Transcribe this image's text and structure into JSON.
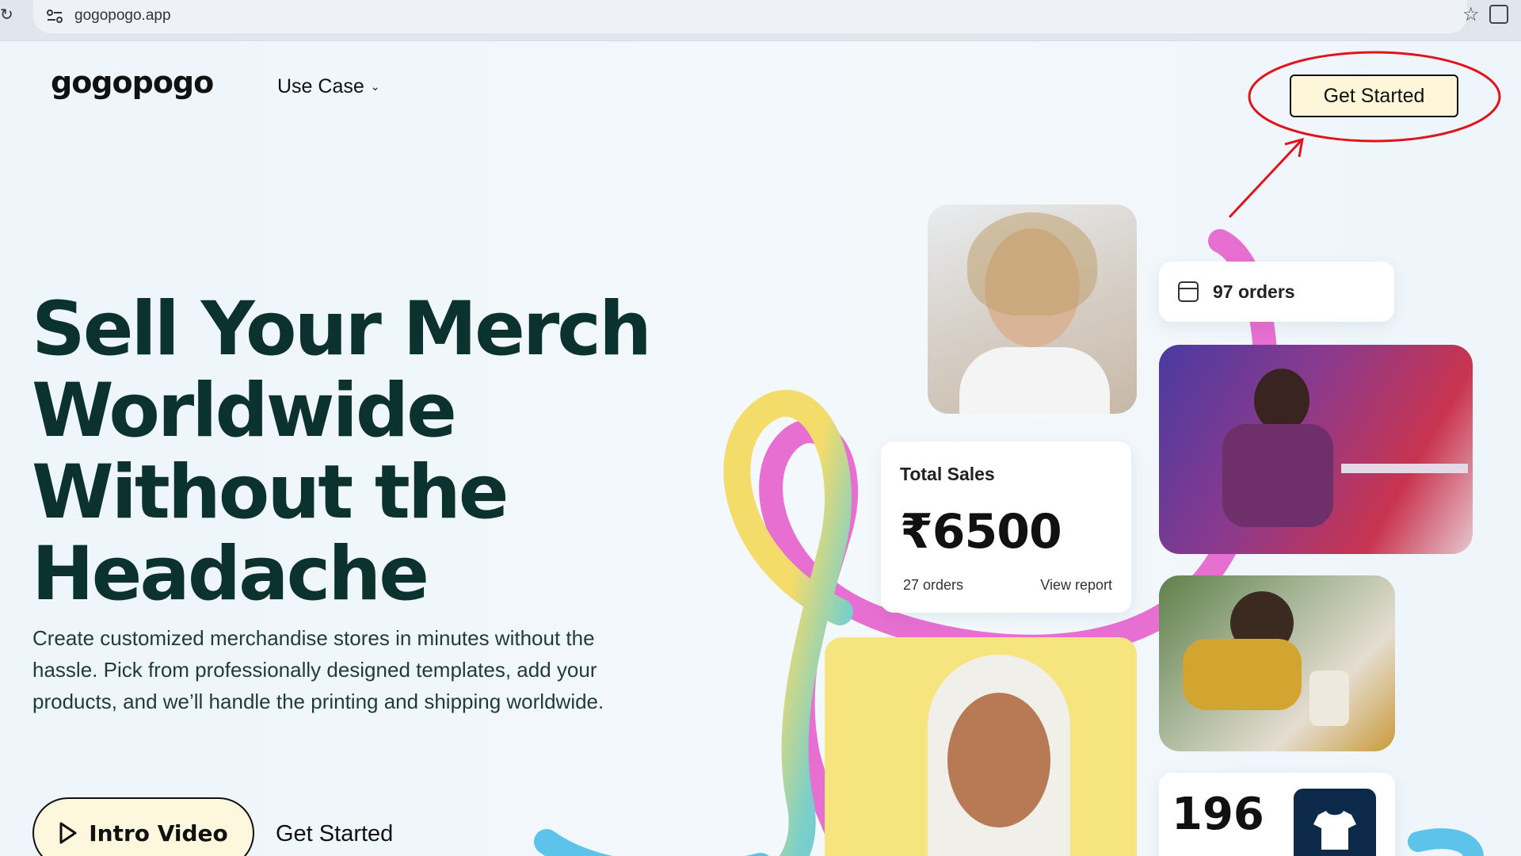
{
  "browser": {
    "url": "gogopogo.app",
    "reload_icon": "reload-icon",
    "site_info_icon": "site-info-icon",
    "bookmark_icon": "star-icon",
    "extensions_icon": "extensions-icon"
  },
  "header": {
    "logo": "gogopogo",
    "nav_usecase": "Use Case",
    "cta": "Get Started"
  },
  "hero": {
    "title_lines": [
      "Sell Your Merch",
      "Worldwide",
      "Without the",
      "Headache"
    ],
    "description": "Create customized merchandise stores in minutes without the hassle. Pick from professionally designed templates, add your products, and we’ll handle the printing and shipping worldwide.",
    "intro_video_label": "Intro Video",
    "get_started_link": "Get Started"
  },
  "cards": {
    "orders": "97 orders",
    "total_sales_label": "Total Sales",
    "total_sales_amount": "₹6500",
    "total_sales_orders": "27 orders",
    "view_report": "View report",
    "count_196": "196"
  },
  "colors": {
    "title": "#0b322e",
    "cta_bg": "#fdf6d8",
    "annotation": "#e0151b",
    "ribbon_yellow": "#f3dc6a",
    "ribbon_pink": "#e76fd2",
    "ribbon_blue": "#5ec3ea"
  }
}
